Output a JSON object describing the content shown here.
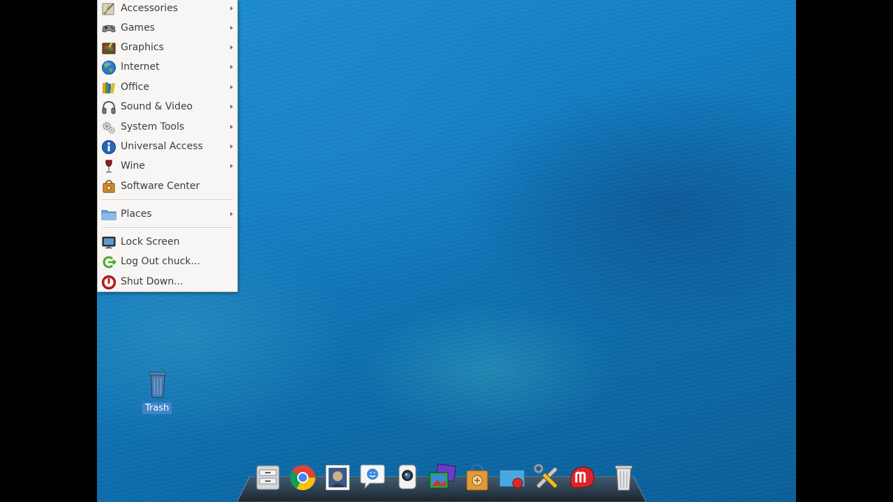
{
  "menu": {
    "items": [
      {
        "label": "Accessories",
        "icon": "accessories-icon",
        "submenu": true
      },
      {
        "label": "Games",
        "icon": "gamepad-icon",
        "submenu": true
      },
      {
        "label": "Graphics",
        "icon": "graphics-icon",
        "submenu": true
      },
      {
        "label": "Internet",
        "icon": "globe-icon",
        "submenu": true
      },
      {
        "label": "Office",
        "icon": "office-icon",
        "submenu": true
      },
      {
        "label": "Sound & Video",
        "icon": "headphones-icon",
        "submenu": true
      },
      {
        "label": "System Tools",
        "icon": "gears-icon",
        "submenu": true
      },
      {
        "label": "Universal Access",
        "icon": "accessibility-icon",
        "submenu": true
      },
      {
        "label": "Wine",
        "icon": "wine-glass-icon",
        "submenu": true
      },
      {
        "label": "Software Center",
        "icon": "software-center-icon",
        "submenu": false
      }
    ],
    "places": {
      "label": "Places",
      "icon": "folder-icon",
      "submenu": true
    },
    "session": [
      {
        "label": "Lock Screen",
        "icon": "lock-screen-icon"
      },
      {
        "label": "Log Out chuck...",
        "icon": "logout-icon"
      },
      {
        "label": "Shut Down...",
        "icon": "power-icon"
      }
    ]
  },
  "desktop": {
    "trash_label": "Trash"
  },
  "dock": {
    "items": [
      "file-manager-icon",
      "chrome-icon",
      "mail-stamp-icon",
      "messaging-icon",
      "webcam-icon",
      "image-viewer-icon",
      "software-center-icon",
      "screen-recorder-icon",
      "system-tools-icon",
      "miro-icon",
      "trash-icon"
    ]
  },
  "colors": {
    "menu_bg": "#f7f6f4",
    "desktop_blue": "#137ec2",
    "selection_blue": "#3f86c8"
  }
}
